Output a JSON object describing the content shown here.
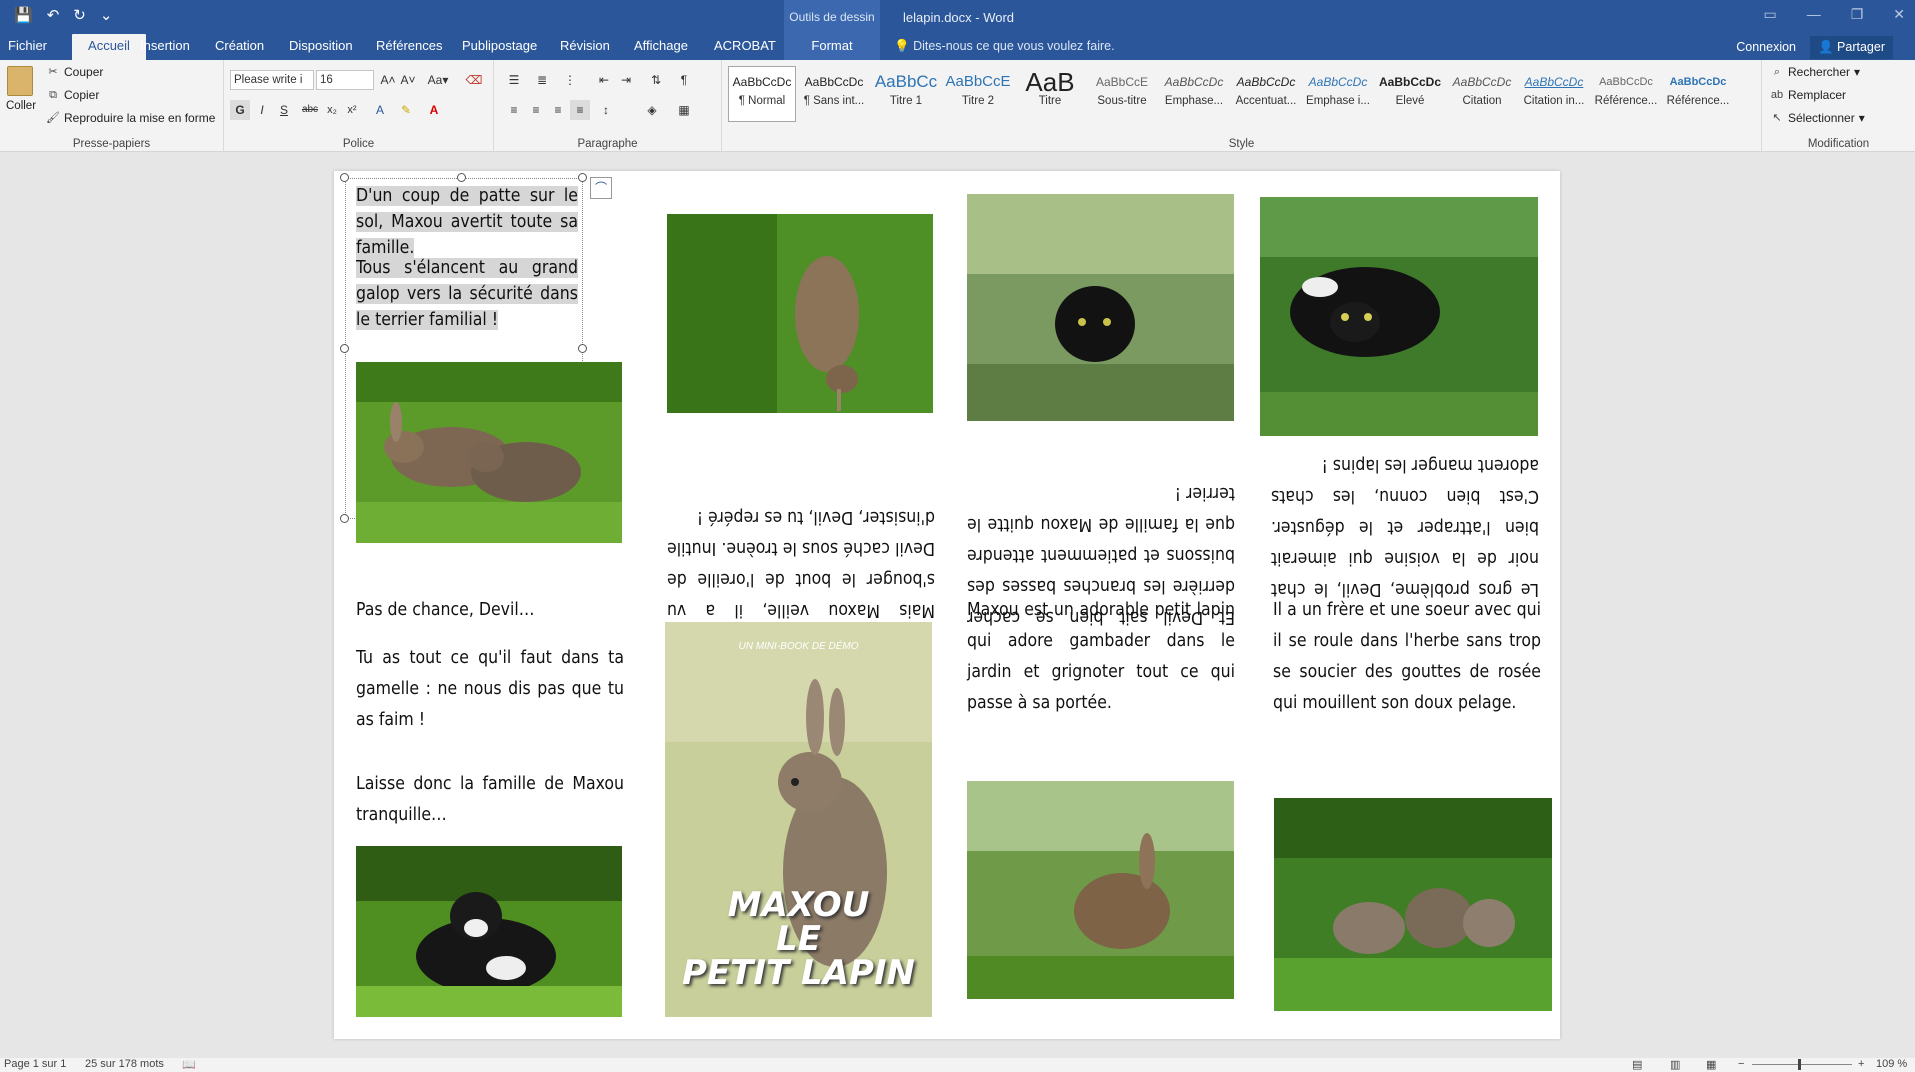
{
  "window": {
    "title": "lelapin.docx - Word",
    "context_tab_group": "Outils de dessin"
  },
  "tabs": [
    {
      "label": "Fichier"
    },
    {
      "label": "Accueil"
    },
    {
      "label": "Insertion"
    },
    {
      "label": "Création"
    },
    {
      "label": "Disposition"
    },
    {
      "label": "Références"
    },
    {
      "label": "Publipostage"
    },
    {
      "label": "Révision"
    },
    {
      "label": "Affichage"
    },
    {
      "label": "ACROBAT"
    },
    {
      "label": "Format"
    }
  ],
  "tell_me": "Dites-nous ce que vous voulez faire.",
  "account": {
    "signin": "Connexion",
    "share": "Partager"
  },
  "clipboard": {
    "paste": "Coller",
    "cut": "Couper",
    "copy": "Copier",
    "format_painter": "Reproduire la mise en forme",
    "group": "Presse-papiers"
  },
  "font": {
    "name": "Please write i",
    "size": "16",
    "group": "Police"
  },
  "paragraph": {
    "group": "Paragraphe"
  },
  "styles": {
    "group": "Style",
    "items": [
      {
        "preview": "AaBbCcDc",
        "name": "¶ Normal"
      },
      {
        "preview": "AaBbCcDc",
        "name": "¶ Sans int..."
      },
      {
        "preview": "AaBbCc",
        "name": "Titre 1"
      },
      {
        "preview": "AaBbCcE",
        "name": "Titre 2"
      },
      {
        "preview": "AaB",
        "name": "Titre"
      },
      {
        "preview": "AaBbCcE",
        "name": "Sous-titre"
      },
      {
        "preview": "AaBbCcDc",
        "name": "Emphase..."
      },
      {
        "preview": "AaBbCcDc",
        "name": "Accentuat..."
      },
      {
        "preview": "AaBbCcDc",
        "name": "Emphase i..."
      },
      {
        "preview": "AaBbCcDc",
        "name": "Élevé"
      },
      {
        "preview": "AaBbCcDc",
        "name": "Citation"
      },
      {
        "preview": "AaBbCcDc",
        "name": "Citation in..."
      },
      {
        "preview": "AaBbCcDc",
        "name": "Référence..."
      },
      {
        "preview": "AaBbCcDc",
        "name": "Référence..."
      }
    ]
  },
  "editing": {
    "find": "Rechercher",
    "replace": "Remplacer",
    "select": "Sélectionner",
    "group": "Modification"
  },
  "doc": {
    "p1": "D'un coup de patte sur le sol, Maxou avertit toute sa famille.",
    "p2": "Tous s'élancent au grand galop vers la sécurité dans le terrier familial !",
    "flip1": "Mais Maxou veille, il a vu s'bouger le bout de l'oreille de Devil caché sous le troène. Inutile d'insister, Devil, tu es repéré !",
    "flip2": "Et Devil sait bien se cacher derrière les branches basses des buissons et patiemment attendre que la famille de Maxou quitte le terrier !",
    "flip3": "Le gros problème, Devil, le chat noir de la voisine qui aimerait bien l'attraper et le déguster. C'est bien connu, les chats adorent manger les lapins !",
    "p3a": "Pas de chance, Devil…",
    "p3b": "Tu as tout ce qu'il faut dans ta gamelle : ne nous dis pas que tu as faim !",
    "p3c": "Laisse donc la famille de Maxou tranquille…",
    "p4": "Maxou est un adorable petit lapin qui adore gambader dans le jardin et grignoter tout ce qui passe à sa portée.",
    "p5": "Il a un frère et une soeur avec qui il se roule dans l'herbe sans trop se soucier des gouttes de rosée qui mouillent son doux pelage.",
    "cover_small": "UN MINI-BOOK DE DÉMO",
    "cover_title1": "MAXOU",
    "cover_title2": "LE",
    "cover_title3": "PETIT LAPIN"
  },
  "status": {
    "page": "Page 1 sur 1",
    "words": "25 sur 178 mots",
    "zoom": "109 %"
  },
  "colors": {
    "accent": "#2b579a",
    "ribbon": "#f3f3f3"
  }
}
